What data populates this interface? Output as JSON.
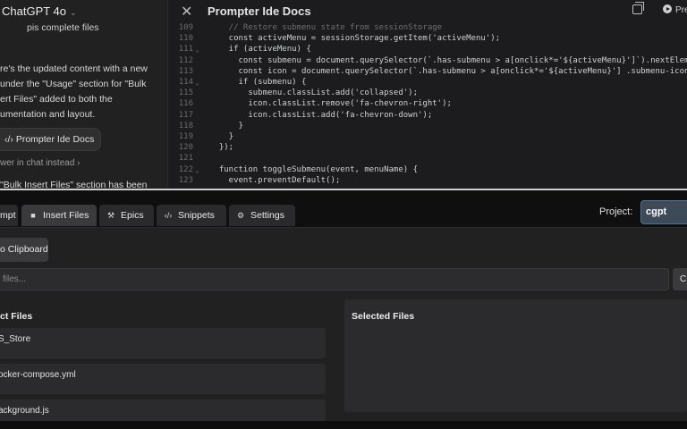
{
  "chat": {
    "title": "ChatGPT 4o",
    "partial_line": "pis complete files",
    "message_lines": [
      "re's the updated content with a new",
      "under the \"Usage\" section for \"Bulk",
      "ert Files\" added to both the",
      "umentation and layout."
    ],
    "doc_button": "‹/› Prompter Ide Docs",
    "answer_in_chat": "wer in chat instead ›",
    "trailing_line": "\"Bulk Insert Files\" section has been"
  },
  "editor": {
    "title": "Prompter Ide Docs",
    "preview_label": "Pre",
    "lines": [
      {
        "n": "109",
        "fold": "",
        "text": "    // Restore submenu state from sessionStorage",
        "comment": true
      },
      {
        "n": "110",
        "fold": "",
        "text": "    const activeMenu = sessionStorage.getItem('activeMenu');"
      },
      {
        "n": "111",
        "fold": "⌄",
        "text": "    if (activeMenu) {"
      },
      {
        "n": "112",
        "fold": "",
        "text": "      const submenu = document.querySelector(`.has-submenu > a[onclick*='${activeMenu}']`).nextEleme"
      },
      {
        "n": "113",
        "fold": "",
        "text": "      const icon = document.querySelector(`.has-submenu > a[onclick*='${activeMenu}'] .submenu-icon"
      },
      {
        "n": "114",
        "fold": "⌄",
        "text": "      if (submenu) {"
      },
      {
        "n": "115",
        "fold": "",
        "text": "        submenu.classList.add('collapsed');"
      },
      {
        "n": "116",
        "fold": "",
        "text": "        icon.classList.remove('fa-chevron-right');"
      },
      {
        "n": "117",
        "fold": "",
        "text": "        icon.classList.add('fa-chevron-down');"
      },
      {
        "n": "118",
        "fold": "",
        "text": "      }"
      },
      {
        "n": "119",
        "fold": "",
        "text": "    }"
      },
      {
        "n": "120",
        "fold": "",
        "text": "  });"
      },
      {
        "n": "121",
        "fold": "",
        "text": ""
      },
      {
        "n": "122",
        "fold": "⌄",
        "text": "  function toggleSubmenu(event, menuName) {"
      },
      {
        "n": "123",
        "fold": "",
        "text": "    event.preventDefault();"
      }
    ]
  },
  "app": {
    "tabs": [
      {
        "label": "mpt",
        "icon": ""
      },
      {
        "label": "Insert Files",
        "icon": "■"
      },
      {
        "label": "Epics",
        "icon": "⚒"
      },
      {
        "label": "Snippets",
        "icon": "‹/›"
      },
      {
        "label": "Settings",
        "icon": "⚙"
      }
    ],
    "project_label": "Project:",
    "project_value": "cgpt",
    "clipboard_button": "o Clipboard",
    "search_placeholder": "files...",
    "search_button": "C",
    "project_files_heading": "ct Files",
    "files": [
      "S_Store",
      "ocker-compose.yml",
      "ackground.js"
    ],
    "selected_files_heading": "Selected Files"
  }
}
